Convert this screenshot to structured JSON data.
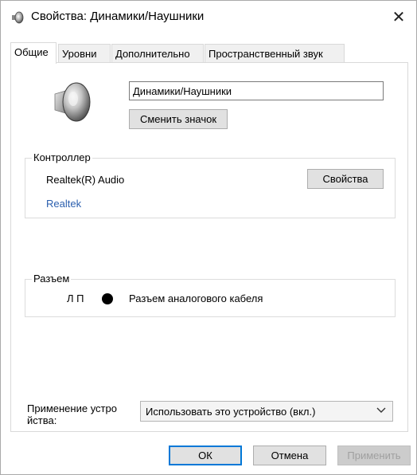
{
  "window": {
    "title": "Свойства: Динамики/Наушники"
  },
  "tabs": [
    {
      "label": "Общие",
      "active": true
    },
    {
      "label": "Уровни",
      "active": false
    },
    {
      "label": "Дополнительно",
      "active": false
    },
    {
      "label": "Пространственный звук",
      "active": false
    }
  ],
  "general": {
    "device_name_value": "Динамики/Наушники",
    "change_icon_label": "Сменить значок",
    "controller": {
      "group_label": "Контроллер",
      "name": "Realtek(R) Audio",
      "link": "Realtek",
      "properties_label": "Свойства"
    },
    "jack": {
      "group_label": "Разъем",
      "channels": "Л П",
      "description": "Разъем аналогового кабеля"
    },
    "usage": {
      "label": "Применение устро йства:",
      "selected": "Использовать это устройство (вкл.)"
    }
  },
  "buttons": {
    "ok": "ОК",
    "cancel": "Отмена",
    "apply": "Применить"
  },
  "colors": {
    "link": "#2b5fae",
    "default_button_border": "#0078d7",
    "disabled_text": "#a0a0a0"
  },
  "icons": {
    "title": "speaker-icon",
    "device": "speaker-icon",
    "close": "close-icon",
    "dropdown": "chevron-down-icon"
  }
}
